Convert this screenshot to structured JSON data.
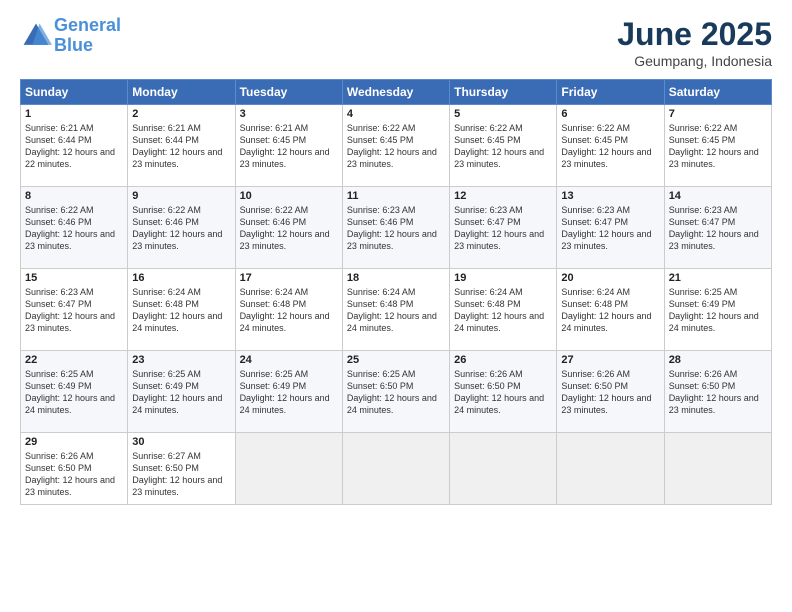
{
  "logo": {
    "line1": "General",
    "line2": "Blue"
  },
  "title": "June 2025",
  "subtitle": "Geumpang, Indonesia",
  "days_header": [
    "Sunday",
    "Monday",
    "Tuesday",
    "Wednesday",
    "Thursday",
    "Friday",
    "Saturday"
  ],
  "weeks": [
    [
      {
        "day": "1",
        "sunrise": "6:21 AM",
        "sunset": "6:44 PM",
        "daylight": "12 hours and 22 minutes."
      },
      {
        "day": "2",
        "sunrise": "6:21 AM",
        "sunset": "6:44 PM",
        "daylight": "12 hours and 23 minutes."
      },
      {
        "day": "3",
        "sunrise": "6:21 AM",
        "sunset": "6:45 PM",
        "daylight": "12 hours and 23 minutes."
      },
      {
        "day": "4",
        "sunrise": "6:22 AM",
        "sunset": "6:45 PM",
        "daylight": "12 hours and 23 minutes."
      },
      {
        "day": "5",
        "sunrise": "6:22 AM",
        "sunset": "6:45 PM",
        "daylight": "12 hours and 23 minutes."
      },
      {
        "day": "6",
        "sunrise": "6:22 AM",
        "sunset": "6:45 PM",
        "daylight": "12 hours and 23 minutes."
      },
      {
        "day": "7",
        "sunrise": "6:22 AM",
        "sunset": "6:45 PM",
        "daylight": "12 hours and 23 minutes."
      }
    ],
    [
      {
        "day": "8",
        "sunrise": "6:22 AM",
        "sunset": "6:46 PM",
        "daylight": "12 hours and 23 minutes."
      },
      {
        "day": "9",
        "sunrise": "6:22 AM",
        "sunset": "6:46 PM",
        "daylight": "12 hours and 23 minutes."
      },
      {
        "day": "10",
        "sunrise": "6:22 AM",
        "sunset": "6:46 PM",
        "daylight": "12 hours and 23 minutes."
      },
      {
        "day": "11",
        "sunrise": "6:23 AM",
        "sunset": "6:46 PM",
        "daylight": "12 hours and 23 minutes."
      },
      {
        "day": "12",
        "sunrise": "6:23 AM",
        "sunset": "6:47 PM",
        "daylight": "12 hours and 23 minutes."
      },
      {
        "day": "13",
        "sunrise": "6:23 AM",
        "sunset": "6:47 PM",
        "daylight": "12 hours and 23 minutes."
      },
      {
        "day": "14",
        "sunrise": "6:23 AM",
        "sunset": "6:47 PM",
        "daylight": "12 hours and 23 minutes."
      }
    ],
    [
      {
        "day": "15",
        "sunrise": "6:23 AM",
        "sunset": "6:47 PM",
        "daylight": "12 hours and 23 minutes."
      },
      {
        "day": "16",
        "sunrise": "6:24 AM",
        "sunset": "6:48 PM",
        "daylight": "12 hours and 24 minutes."
      },
      {
        "day": "17",
        "sunrise": "6:24 AM",
        "sunset": "6:48 PM",
        "daylight": "12 hours and 24 minutes."
      },
      {
        "day": "18",
        "sunrise": "6:24 AM",
        "sunset": "6:48 PM",
        "daylight": "12 hours and 24 minutes."
      },
      {
        "day": "19",
        "sunrise": "6:24 AM",
        "sunset": "6:48 PM",
        "daylight": "12 hours and 24 minutes."
      },
      {
        "day": "20",
        "sunrise": "6:24 AM",
        "sunset": "6:48 PM",
        "daylight": "12 hours and 24 minutes."
      },
      {
        "day": "21",
        "sunrise": "6:25 AM",
        "sunset": "6:49 PM",
        "daylight": "12 hours and 24 minutes."
      }
    ],
    [
      {
        "day": "22",
        "sunrise": "6:25 AM",
        "sunset": "6:49 PM",
        "daylight": "12 hours and 24 minutes."
      },
      {
        "day": "23",
        "sunrise": "6:25 AM",
        "sunset": "6:49 PM",
        "daylight": "12 hours and 24 minutes."
      },
      {
        "day": "24",
        "sunrise": "6:25 AM",
        "sunset": "6:49 PM",
        "daylight": "12 hours and 24 minutes."
      },
      {
        "day": "25",
        "sunrise": "6:25 AM",
        "sunset": "6:50 PM",
        "daylight": "12 hours and 24 minutes."
      },
      {
        "day": "26",
        "sunrise": "6:26 AM",
        "sunset": "6:50 PM",
        "daylight": "12 hours and 24 minutes."
      },
      {
        "day": "27",
        "sunrise": "6:26 AM",
        "sunset": "6:50 PM",
        "daylight": "12 hours and 23 minutes."
      },
      {
        "day": "28",
        "sunrise": "6:26 AM",
        "sunset": "6:50 PM",
        "daylight": "12 hours and 23 minutes."
      }
    ],
    [
      {
        "day": "29",
        "sunrise": "6:26 AM",
        "sunset": "6:50 PM",
        "daylight": "12 hours and 23 minutes."
      },
      {
        "day": "30",
        "sunrise": "6:27 AM",
        "sunset": "6:50 PM",
        "daylight": "12 hours and 23 minutes."
      },
      null,
      null,
      null,
      null,
      null
    ]
  ]
}
